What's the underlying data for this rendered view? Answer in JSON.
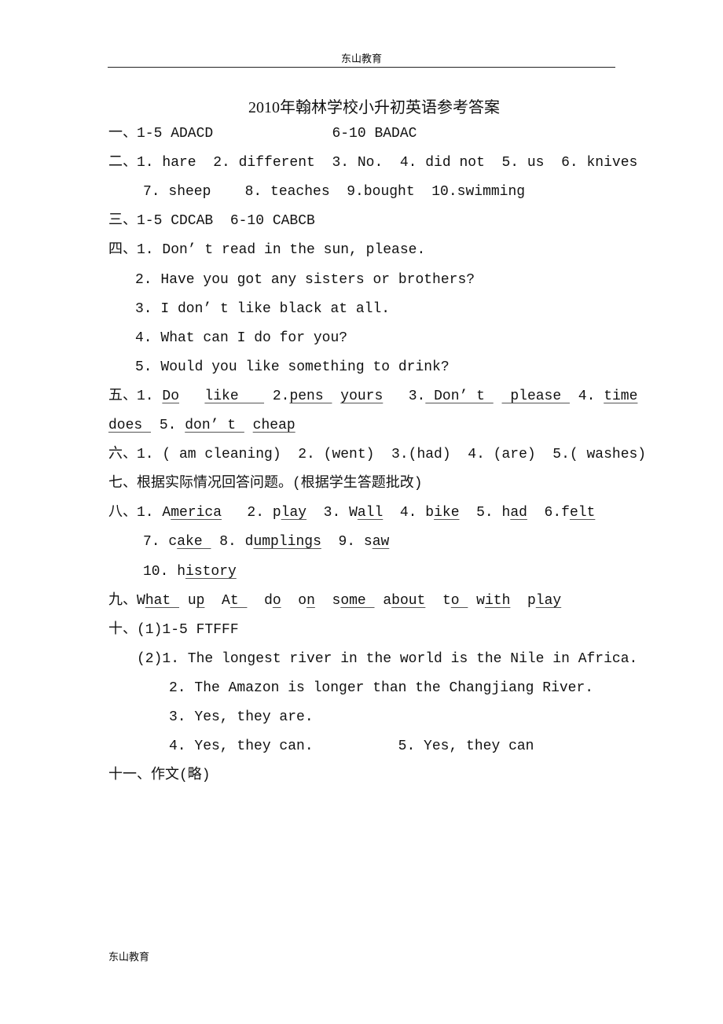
{
  "header": {
    "text": "东山教育"
  },
  "footer": {
    "text": "东山教育"
  },
  "title": "2010年翰林学校小升初英语参考答案",
  "lines": [
    [
      {
        "t": "一、1-5 ADACD              6-10 BADAC"
      }
    ],
    [
      {
        "t": "二、1. hare  2. different  3. No.  4. did not  5. us  6. knives"
      }
    ],
    [
      {
        "t": "7. sheep    8. teaches  9.bought  10.swimming"
      }
    ],
    [
      {
        "t": "三、1-5 CDCAB  6-10 CABCB"
      }
    ],
    [
      {
        "t": "四、1. Don’ t read in the sun, please."
      }
    ],
    [
      {
        "t": "2. Have you got any sisters or brothers?"
      }
    ],
    [
      {
        "t": "3. I don’ t like black at all."
      }
    ],
    [
      {
        "t": "4. What can I do for you?"
      }
    ],
    [
      {
        "t": "5. Would you like something to drink?"
      }
    ],
    [
      {
        "t": "五、1. "
      },
      {
        "t": "Do",
        "u": true
      },
      {
        "t": "   "
      },
      {
        "t": "like   ",
        "u": true
      },
      {
        "t": " 2."
      },
      {
        "t": "pens ",
        "u": true
      },
      {
        "t": " "
      },
      {
        "t": "yours",
        "u": true
      },
      {
        "t": "   3."
      },
      {
        "t": " Don’ t ",
        "u": true
      },
      {
        "t": " "
      },
      {
        "t": " please ",
        "u": true
      },
      {
        "t": " 4. "
      },
      {
        "t": "time",
        "u": true
      }
    ],
    [
      {
        "t": "does ",
        "u": true
      },
      {
        "t": " 5. "
      },
      {
        "t": "don’ t ",
        "u": true
      },
      {
        "t": " "
      },
      {
        "t": "cheap",
        "u": true
      }
    ],
    [
      {
        "t": "六、1. ( am cleaning)  2. (went)  3.(had)  4. (are)  5.( washes)"
      }
    ],
    [
      {
        "t": "七、根据实际情况回答问题。(根据学生答题批改)"
      }
    ],
    [
      {
        "t": "八、1. A"
      },
      {
        "t": "merica",
        "u": true
      },
      {
        "t": "   2. p"
      },
      {
        "t": "lay",
        "u": true
      },
      {
        "t": "  3. W"
      },
      {
        "t": "all",
        "u": true
      },
      {
        "t": "  4. b"
      },
      {
        "t": "ike",
        "u": true
      },
      {
        "t": "  5. h"
      },
      {
        "t": "ad",
        "u": true
      },
      {
        "t": "  6.f"
      },
      {
        "t": "elt",
        "u": true
      }
    ],
    [
      {
        "t": "7. c"
      },
      {
        "t": "ake ",
        "u": true
      },
      {
        "t": " 8. d"
      },
      {
        "t": "umplings",
        "u": true
      },
      {
        "t": "  9. s"
      },
      {
        "t": "aw",
        "u": true
      }
    ],
    [
      {
        "t": "10. h"
      },
      {
        "t": "istory",
        "u": true
      }
    ],
    [
      {
        "t": "九、W"
      },
      {
        "t": "hat ",
        "u": true
      },
      {
        "t": " u"
      },
      {
        "t": "p",
        "u": true
      },
      {
        "t": "  A"
      },
      {
        "t": "t ",
        "u": true
      },
      {
        "t": "  d"
      },
      {
        "t": "o",
        "u": true
      },
      {
        "t": "  o"
      },
      {
        "t": "n",
        "u": true
      },
      {
        "t": "  s"
      },
      {
        "t": "ome ",
        "u": true
      },
      {
        "t": " a"
      },
      {
        "t": "bout",
        "u": true
      },
      {
        "t": "  t"
      },
      {
        "t": "o ",
        "u": true
      },
      {
        "t": " w"
      },
      {
        "t": "ith",
        "u": true
      },
      {
        "t": "  p"
      },
      {
        "t": "lay",
        "u": true
      }
    ],
    [
      {
        "t": "十、(1)1-5 FTFFF"
      }
    ],
    [
      {
        "t": "(2)1. The longest river in the world is the Nile in Africa."
      }
    ],
    [
      {
        "t": "2. The Amazon is longer than the Changjiang River."
      }
    ],
    [
      {
        "t": "3. Yes, they are."
      }
    ],
    [
      {
        "t": "4. Yes, they can.          5. Yes, they can"
      }
    ],
    [
      {
        "t": "十一、作文(略)"
      }
    ]
  ]
}
